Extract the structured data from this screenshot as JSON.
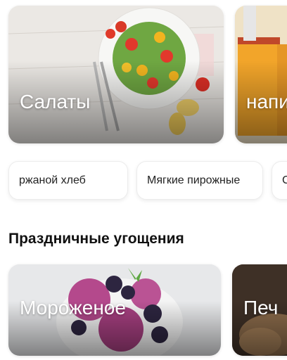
{
  "top_cards": [
    {
      "label": "Салаты",
      "image": "salad-photo"
    },
    {
      "label": "напи",
      "image": "drinks-photo"
    }
  ],
  "chips": [
    {
      "label": "ржаной хлеб"
    },
    {
      "label": "Мягкие пирожные"
    },
    {
      "label": "С"
    }
  ],
  "section": {
    "title": "Праздничные угощения"
  },
  "bottom_cards": [
    {
      "label": "Мороженое",
      "image": "ice-cream-photo"
    },
    {
      "label": "Печ",
      "image": "baking-photo"
    }
  ]
}
